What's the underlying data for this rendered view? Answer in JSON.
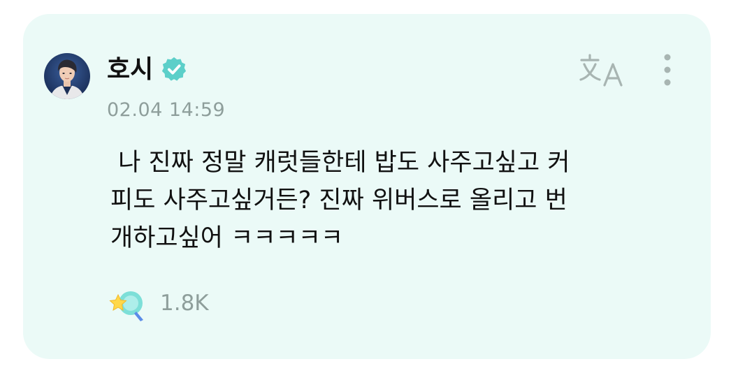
{
  "post": {
    "author": {
      "name": "호시",
      "avatar_icon": "profile-photo",
      "verified_icon": "verified-badge-icon",
      "verified_color": "#5ccfc9"
    },
    "timestamp": "02.04 14:59",
    "body": " 나 진짜 정말 캐럿들한테 밥도 사주고싶고 커\n피도 사주고싶거든? 진짜 위버스로 올리고 번\n개하고싶어 ㅋㅋㅋㅋㅋ",
    "actions": {
      "translate_icon": "translate-icon",
      "more_icon": "more-vertical-icon"
    },
    "reaction": {
      "icon": "star-bubble-icon",
      "count": "1.8K"
    }
  },
  "colors": {
    "card_background": "#ebfaf7",
    "text_primary": "#111111",
    "text_secondary": "#8e9e9b",
    "accent": "#5ccfc9"
  }
}
